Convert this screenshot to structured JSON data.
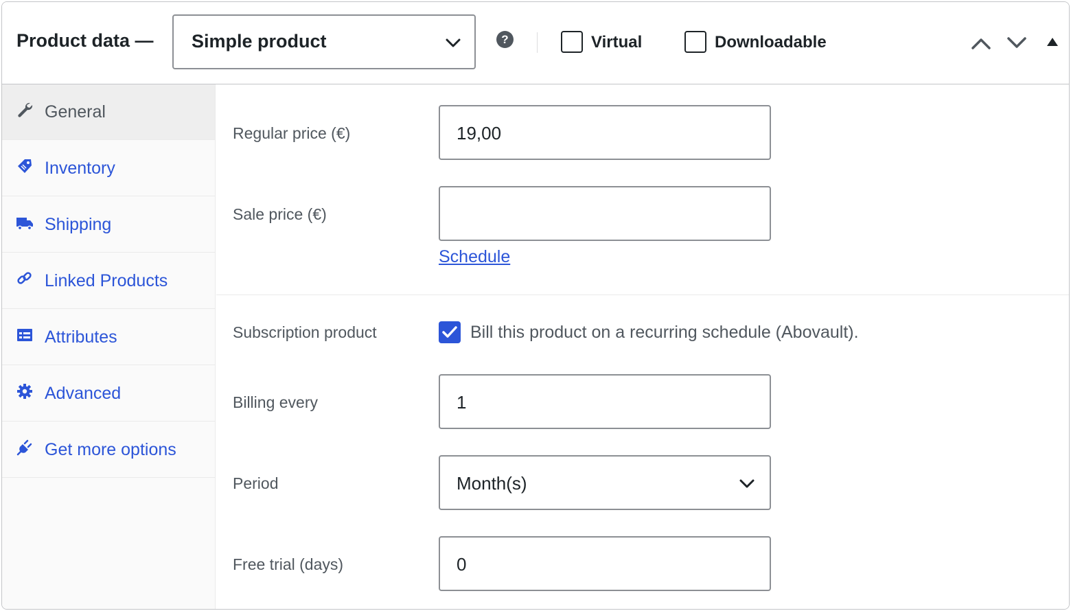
{
  "header": {
    "title": "Product data —",
    "product_type": "Simple product",
    "help_icon": "question-circle-icon",
    "virtual_label": "Virtual",
    "virtual_checked": false,
    "downloadable_label": "Downloadable",
    "downloadable_checked": false
  },
  "sidebar": {
    "items": [
      {
        "label": "General",
        "icon": "wrench-icon",
        "active": true
      },
      {
        "label": "Inventory",
        "icon": "tag-icon",
        "active": false
      },
      {
        "label": "Shipping",
        "icon": "truck-icon",
        "active": false
      },
      {
        "label": "Linked Products",
        "icon": "link-icon",
        "active": false
      },
      {
        "label": "Attributes",
        "icon": "list-icon",
        "active": false
      },
      {
        "label": "Advanced",
        "icon": "gear-icon",
        "active": false
      },
      {
        "label": "Get more options",
        "icon": "plug-icon",
        "active": false
      }
    ]
  },
  "general": {
    "regular_price_label": "Regular price (€)",
    "regular_price_value": "19,00",
    "sale_price_label": "Sale price (€)",
    "sale_price_value": "",
    "schedule_link": "Schedule",
    "subscription_label": "Subscription product",
    "subscription_checkbox_text": "Bill this product on a recurring schedule (Abovault).",
    "subscription_checked": true,
    "billing_every_label": "Billing every",
    "billing_every_value": "1",
    "period_label": "Period",
    "period_value": "Month(s)",
    "free_trial_label": "Free trial (days)",
    "free_trial_value": "0"
  },
  "colors": {
    "accent": "#2c55d8",
    "text": "#1d2327",
    "muted": "#50575e",
    "border": "#8c8f94"
  }
}
